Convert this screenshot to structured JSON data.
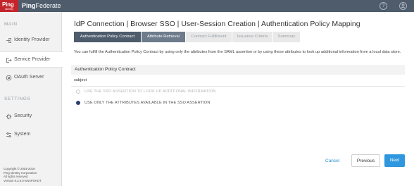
{
  "header": {
    "logo_text": "Ping",
    "logo_subtext": "Identity",
    "brand_bold": "Ping",
    "brand_rest": "Federate",
    "help_icon": "?",
    "user_icon": "person-icon"
  },
  "sidebar": {
    "main_section": "MAIN",
    "settings_section": "SETTINGS",
    "items": [
      {
        "label": "Identity Provider",
        "icon": "sign-in-icon"
      },
      {
        "label": "Service Provider",
        "icon": "sign-out-icon"
      },
      {
        "label": "OAuth Server",
        "icon": "gear-icon"
      },
      {
        "label": "Security",
        "icon": "settings-icon"
      },
      {
        "label": "System",
        "icon": "sliders-icon"
      }
    ],
    "copyright_line1": "Copyright © 2003-2019",
    "copyright_line2": "Ping Identity Corporation",
    "copyright_line3": "All rights reserved",
    "copyright_line4": "Version 9.3.0.0-SNAPSHOT"
  },
  "main": {
    "title": "IdP Connection | Browser SSO | User-Session Creation | Authentication Policy Mapping",
    "tabs": [
      {
        "label": "Authentication Policy Contract"
      },
      {
        "label": "Attribute Retrieval"
      },
      {
        "label": "Contract Fulfillment"
      },
      {
        "label": "Issuance Criteria"
      },
      {
        "label": "Summary"
      }
    ],
    "description": "You can fulfill the Authentication Policy Contract by using only the attributes from the SAML assertion or by using these attributes to look up additional information from a local data store.",
    "section_label": "Authentication Policy Contract",
    "attribute": "subject",
    "options": [
      {
        "label": "USE THE SSO ASSERTION TO LOOK UP ADDITIONAL INFORMATION",
        "checked": false
      },
      {
        "label": "USE ONLY THE ATTRIBUTES AVAILABLE IN THE SSO ASSERTION",
        "checked": true
      }
    ]
  },
  "footer": {
    "cancel": "Cancel",
    "previous": "Previous",
    "next": "Next"
  },
  "colors": {
    "topbar": "#4e5c6c",
    "brand_red": "#c4242b",
    "active_tab": "#4e5c6c",
    "next_button": "#2e97dd"
  }
}
